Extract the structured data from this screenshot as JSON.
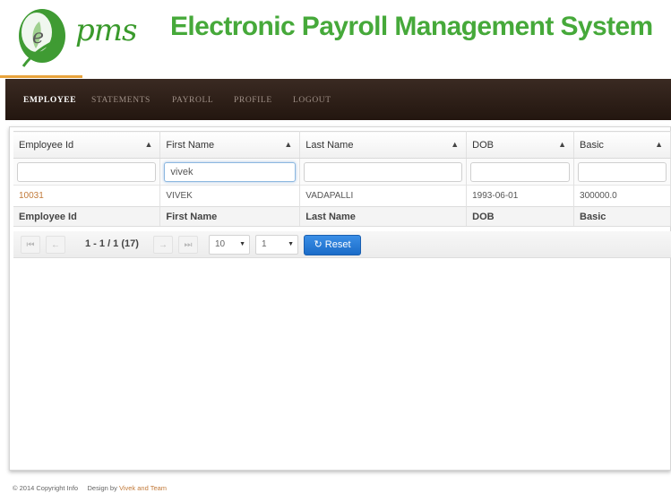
{
  "header": {
    "brand": "pms",
    "title": "Electronic Payroll Management System"
  },
  "nav": {
    "items": [
      {
        "label": "EMPLOYEE"
      },
      {
        "label": "STATEMENTS"
      },
      {
        "label": "PAYROLL"
      },
      {
        "label": "PROFILE"
      },
      {
        "label": "LOGOUT"
      }
    ]
  },
  "table": {
    "columns": [
      "Employee Id",
      "First Name",
      "Last Name",
      "DOB",
      "Basic"
    ],
    "filters": [
      "",
      "vivek",
      "",
      "",
      ""
    ],
    "rows": [
      [
        "10031",
        "VIVEK",
        "VADAPALLI",
        "1993-06-01",
        "300000.0"
      ]
    ]
  },
  "pager": {
    "page_info": "1 - 1 / 1 (17)",
    "rows_per_page": "10",
    "page_select": "1",
    "reset_label": "Reset"
  },
  "footer": {
    "copyright": "© 2014 Copyright Info",
    "design_prefix": "Design by",
    "design_link": "Vivek and Team"
  },
  "colors": {
    "brand_green": "#46a93a",
    "nav_bg": "#2c1d15",
    "reset_blue": "#2a7fd8",
    "link_orange": "#c27a3a"
  },
  "icons": {
    "sort": "sort-arrows-icon",
    "first": "first-page-icon",
    "prev": "prev-page-icon",
    "next": "next-page-icon",
    "last": "last-page-icon",
    "reset": "refresh-icon"
  }
}
